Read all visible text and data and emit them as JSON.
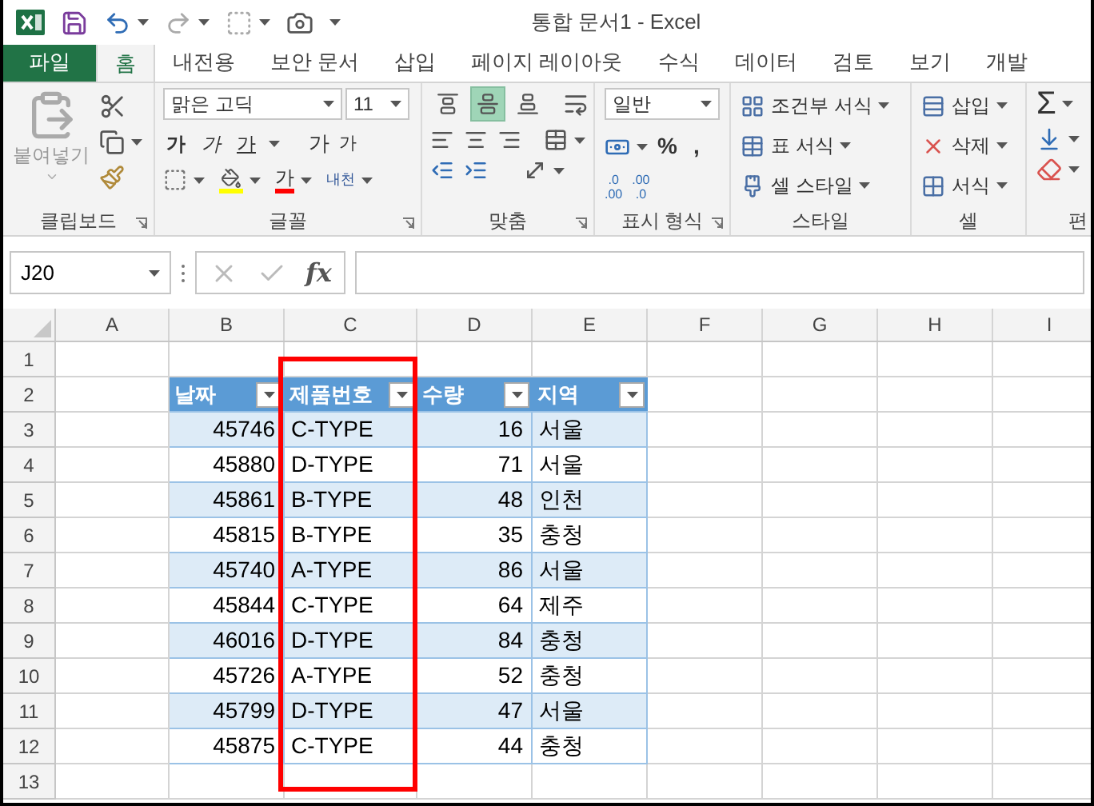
{
  "title": "통합 문서1 - Excel",
  "tabs": [
    {
      "label": "파일",
      "kind": "file",
      "selected": false
    },
    {
      "label": "홈",
      "kind": "tab",
      "selected": true
    },
    {
      "label": "내전용",
      "kind": "tab",
      "selected": false
    },
    {
      "label": "보안 문서",
      "kind": "tab",
      "selected": false
    },
    {
      "label": "삽입",
      "kind": "tab",
      "selected": false
    },
    {
      "label": "페이지 레이아웃",
      "kind": "tab",
      "selected": false
    },
    {
      "label": "수식",
      "kind": "tab",
      "selected": false
    },
    {
      "label": "데이터",
      "kind": "tab",
      "selected": false
    },
    {
      "label": "검토",
      "kind": "tab",
      "selected": false
    },
    {
      "label": "보기",
      "kind": "tab",
      "selected": false
    },
    {
      "label": "개발",
      "kind": "tab",
      "selected": false
    }
  ],
  "ribbon": {
    "clipboard": {
      "paste": "붙여넣기",
      "label": "클립보드"
    },
    "font": {
      "name": "맑은 고딕",
      "size": "11",
      "bold": "가",
      "italic": "가",
      "underline": "가",
      "grow": "가",
      "shrink": "가",
      "font_color_label": "가",
      "phonetic": "내천",
      "label": "글꼴"
    },
    "alignment": {
      "vertical": [
        {
          "kind": "top",
          "selected": false
        },
        {
          "kind": "middle",
          "selected": true
        },
        {
          "kind": "bottom",
          "selected": false
        }
      ],
      "label": "맞춤"
    },
    "number": {
      "format": "일반",
      "percent": "%",
      "comma": ",",
      "decimals": [
        {
          "top": ".0",
          "bottom": ".00"
        },
        {
          "top": ".00",
          "bottom": ".0"
        }
      ],
      "label": "표시 형식"
    },
    "styles": {
      "items": [
        {
          "kind": "conditional",
          "label": "조건부 서식"
        },
        {
          "kind": "table",
          "label": "표 서식"
        },
        {
          "kind": "cell",
          "label": "셀 스타일"
        }
      ],
      "label": "스타일"
    },
    "cells": {
      "items": [
        {
          "kind": "insert",
          "label": "삽입"
        },
        {
          "kind": "delete",
          "label": "삭제"
        },
        {
          "kind": "format",
          "label": "서식"
        }
      ],
      "label": "셀"
    },
    "editing": {
      "sum": "Σ",
      "label": "편"
    }
  },
  "formula_bar": {
    "name_box": "J20",
    "fx": "fx"
  },
  "sheet": {
    "columns": [
      "A",
      "B",
      "C",
      "D",
      "E",
      "F",
      "G",
      "H",
      "I"
    ],
    "rows": [
      "1",
      "2",
      "3",
      "4",
      "5",
      "6",
      "7",
      "8",
      "9",
      "10",
      "11",
      "12",
      "13"
    ]
  },
  "table": {
    "headers": [
      "날짜",
      "제품번호",
      "수량",
      "지역"
    ],
    "rows": [
      [
        "45746",
        "C-TYPE",
        "16",
        "서울"
      ],
      [
        "45880",
        "D-TYPE",
        "71",
        "서울"
      ],
      [
        "45861",
        "B-TYPE",
        "48",
        "인천"
      ],
      [
        "45815",
        "B-TYPE",
        "35",
        "충청"
      ],
      [
        "45740",
        "A-TYPE",
        "86",
        "서울"
      ],
      [
        "45844",
        "C-TYPE",
        "64",
        "제주"
      ],
      [
        "46016",
        "D-TYPE",
        "84",
        "충청"
      ],
      [
        "45726",
        "A-TYPE",
        "52",
        "충청"
      ],
      [
        "45799",
        "D-TYPE",
        "47",
        "서울"
      ],
      [
        "45875",
        "C-TYPE",
        "44",
        "충청"
      ]
    ]
  }
}
